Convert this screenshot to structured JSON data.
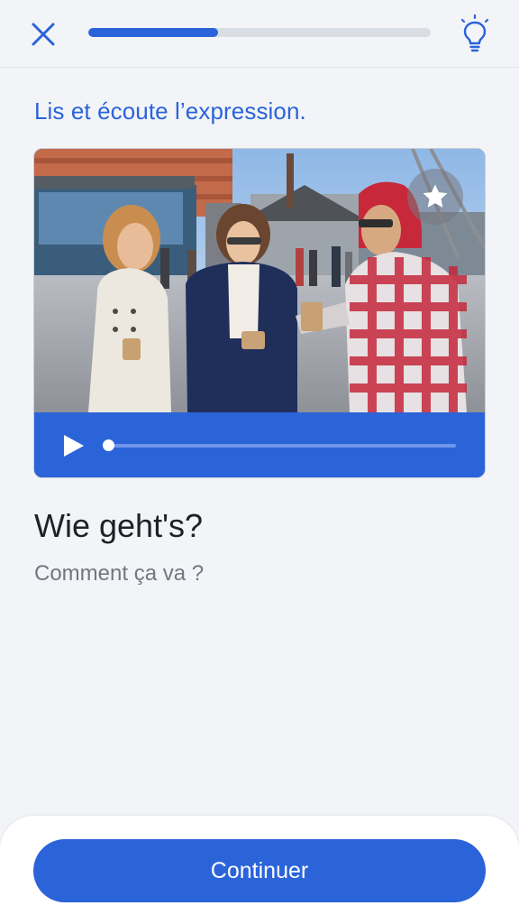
{
  "header": {
    "close_icon": "close-icon",
    "hint_icon": "lightbulb-icon",
    "progress_fraction": 0.38
  },
  "lesson": {
    "instruction": "Lis et écoute l’expression.",
    "phrase": "Wie geht's?",
    "translation": "Comment ça va ?"
  },
  "media": {
    "favorite_icon": "star-icon",
    "play_icon": "play-icon",
    "playback_fraction": 0.0
  },
  "footer": {
    "continue_label": "Continuer"
  },
  "colors": {
    "accent": "#2b63d9",
    "background": "#f2f4f8",
    "progress_track": "#d9dde4",
    "text_primary": "#1e2126",
    "text_secondary": "#73777f"
  }
}
